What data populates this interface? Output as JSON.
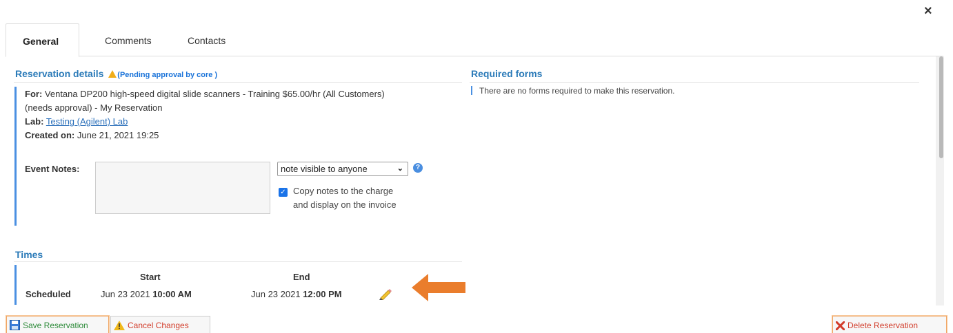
{
  "dialog": {
    "close_glyph": "×"
  },
  "tabs": [
    {
      "label": "General",
      "active": true
    },
    {
      "label": "Comments",
      "active": false
    },
    {
      "label": "Contacts",
      "active": false
    }
  ],
  "reservation": {
    "title": "Reservation details",
    "status": "(Pending approval by core )",
    "for_label": "For:",
    "for_value_line1": "Ventana DP200 high-speed digital slide scanners - Training $65.00/hr (All Customers)",
    "for_value_line2": "(needs approval) - My Reservation",
    "lab_label": "Lab:",
    "lab_value": "Testing (Agilent) Lab",
    "created_label": "Created on:",
    "created_value": "June 21, 2021 19:25",
    "event_notes_label": "Event Notes:",
    "event_notes_value": "",
    "visibility_selected": "note visible to anyone",
    "help_glyph": "?",
    "copy_notes_checked": true,
    "copy_notes_label": "Copy notes to the charge and display on the invoice"
  },
  "times": {
    "title": "Times",
    "start_header": "Start",
    "end_header": "End",
    "row_label": "Scheduled",
    "start_date": "Jun 23 2021",
    "start_time": "10:00 AM",
    "end_date": "Jun 23 2021",
    "end_time": "12:00 PM"
  },
  "required_forms": {
    "title": "Required forms",
    "message": "There are no forms required to make this reservation."
  },
  "footer": {
    "save_label": "Save Reservation",
    "cancel_label": "Cancel Changes",
    "delete_label": "Delete Reservation"
  },
  "colors": {
    "accent_blue": "#2a7ab8",
    "arrow_orange": "#ea7d2c",
    "save_green": "#2e8b3a",
    "danger_red": "#d23c2a"
  },
  "icons": [
    "close-icon",
    "warning-icon",
    "help-icon",
    "checkbox-checked-icon",
    "pencil-icon",
    "arrow-left-icon",
    "save-icon",
    "warning-icon",
    "delete-x-icon"
  ]
}
